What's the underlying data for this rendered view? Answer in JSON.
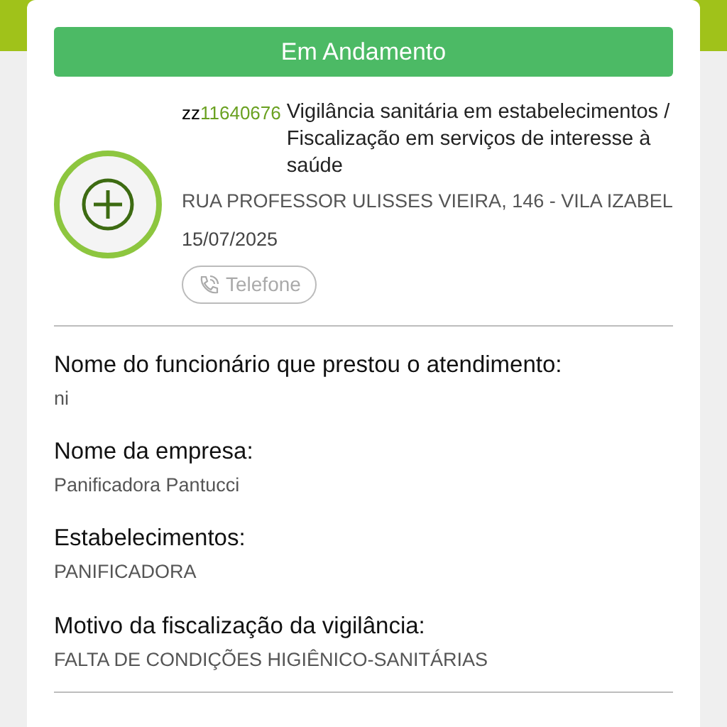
{
  "status_button": "Em Andamento",
  "record": {
    "code_prefix": "zz",
    "code": "11640676",
    "title": "Vigilância sanitária em estabelecimentos / Fiscalização em serviços de interesse à saúde",
    "address": " RUA PROFESSOR ULISSES VIEIRA, 146 - VILA IZABEL",
    "date": "15/07/2025",
    "phone_button": "Telefone"
  },
  "fields": [
    {
      "label": "Nome do funcionário que prestou o atendimento:",
      "value": "ni"
    },
    {
      "label": "Nome da empresa:",
      "value": "Panificadora Pantucci"
    },
    {
      "label": "Estabelecimentos:",
      "value": "PANIFICADORA"
    },
    {
      "label": "Motivo da fiscalização da vigilância:",
      "value": "FALTA DE CONDIÇÕES HIGIÊNICO-SANITÁRIAS"
    }
  ]
}
